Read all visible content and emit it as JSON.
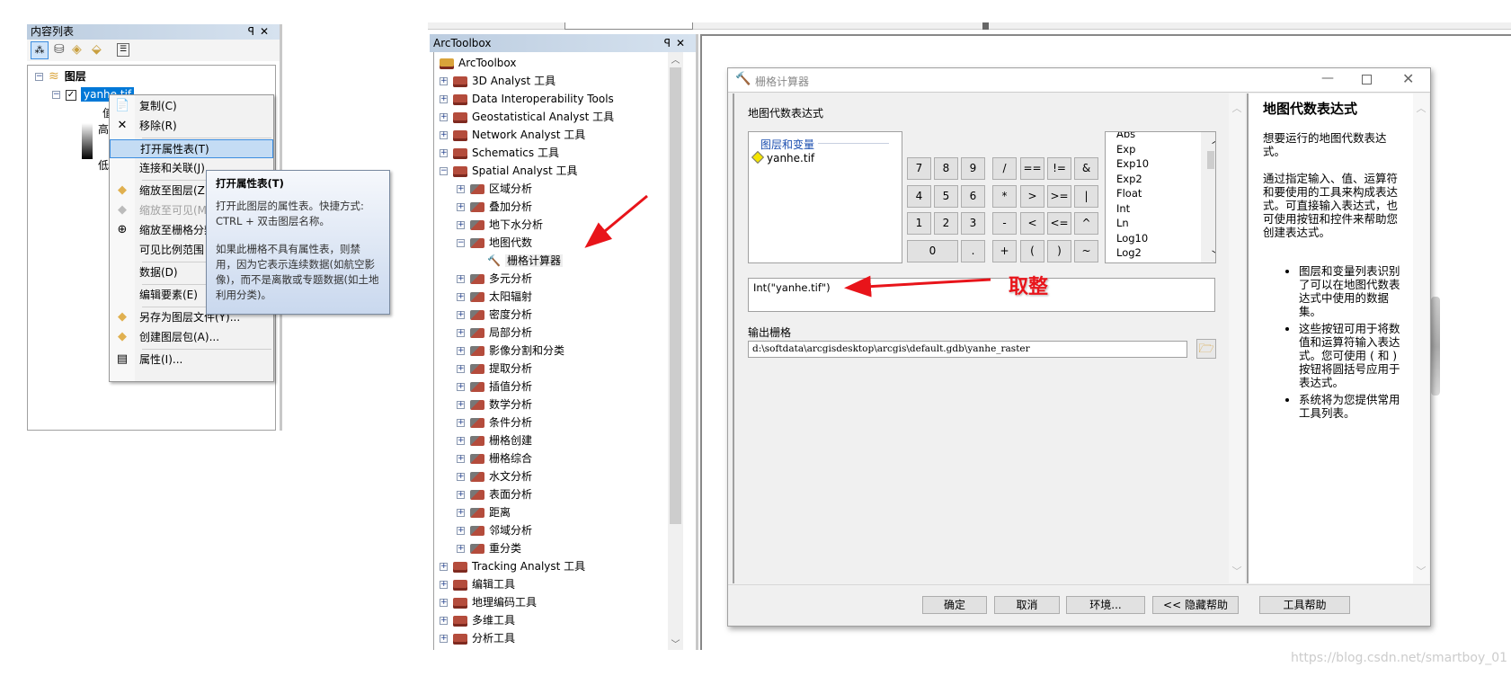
{
  "toc": {
    "title": "内容列表",
    "pin": "ꟼ",
    "close": "✕",
    "layers_label": "图层",
    "layer_name": "yanhe.tif",
    "value_label": "值",
    "high_label": "高",
    "low_label": "低"
  },
  "context_menu": {
    "items": [
      {
        "label": "复制(C)",
        "icon": "copy-icon",
        "glyph": "📄",
        "state": "normal"
      },
      {
        "label": "移除(R)",
        "icon": "remove-icon",
        "glyph": "✕",
        "state": "normal"
      },
      {
        "sep": true
      },
      {
        "label": "打开属性表(T)",
        "icon": "table-icon",
        "glyph": "▦",
        "state": "highlighted"
      },
      {
        "label": "连接和关联(J)",
        "icon": "",
        "glyph": "",
        "state": "normal"
      },
      {
        "sep": true
      },
      {
        "label": "缩放至图层(Z)",
        "icon": "zoom-layer-icon",
        "glyph": "◆",
        "state": "normal"
      },
      {
        "label": "缩放至可见(M)",
        "icon": "zoom-visible-icon",
        "glyph": "◆",
        "state": "disabled"
      },
      {
        "label": "缩放至栅格分辨率",
        "icon": "zoom-raster-icon",
        "glyph": "⊕",
        "state": "normal"
      },
      {
        "label": "可见比例范围",
        "icon": "",
        "glyph": "",
        "state": "normal"
      },
      {
        "sep": true
      },
      {
        "label": "数据(D)",
        "icon": "",
        "glyph": "",
        "state": "normal"
      },
      {
        "sep": true
      },
      {
        "label": "编辑要素(E)",
        "icon": "",
        "glyph": "",
        "state": "normal"
      },
      {
        "sep": true
      },
      {
        "label": "另存为图层文件(Y)...",
        "icon": "layer-file-icon",
        "glyph": "◆",
        "state": "normal"
      },
      {
        "label": "创建图层包(A)...",
        "icon": "layer-package-icon",
        "glyph": "◆",
        "state": "normal"
      },
      {
        "sep": true
      },
      {
        "label": "属性(I)...",
        "icon": "properties-icon",
        "glyph": "▤",
        "state": "normal"
      }
    ]
  },
  "tooltip": {
    "title": "打开属性表(T)",
    "line1": "打开此图层的属性表。快捷方式: CTRL + 双击图层名称。",
    "line2": "如果此栅格不具有属性表，则禁用，因为它表示连续数据(如航空影像)，而不是离散或专题数据(如土地利用分类)。"
  },
  "toolbox": {
    "title": "ArcToolbox",
    "rows": [
      {
        "label": "ArcToolbox",
        "level": 0,
        "type": "root",
        "pm": ""
      },
      {
        "label": "3D Analyst 工具",
        "level": 0,
        "type": "box",
        "pm": "+"
      },
      {
        "label": "Data Interoperability Tools",
        "level": 0,
        "type": "box",
        "pm": "+"
      },
      {
        "label": "Geostatistical Analyst 工具",
        "level": 0,
        "type": "box",
        "pm": "+"
      },
      {
        "label": "Network Analyst 工具",
        "level": 0,
        "type": "box",
        "pm": "+"
      },
      {
        "label": "Schematics 工具",
        "level": 0,
        "type": "box",
        "pm": "+"
      },
      {
        "label": "Spatial Analyst 工具",
        "level": 0,
        "type": "box",
        "pm": "−"
      },
      {
        "label": "区域分析",
        "level": 1,
        "type": "set",
        "pm": "+"
      },
      {
        "label": "叠加分析",
        "level": 1,
        "type": "set",
        "pm": "+"
      },
      {
        "label": "地下水分析",
        "level": 1,
        "type": "set",
        "pm": "+"
      },
      {
        "label": "地图代数",
        "level": 1,
        "type": "set",
        "pm": "−"
      },
      {
        "label": "栅格计算器",
        "level": 2,
        "type": "tool",
        "pm": ""
      },
      {
        "label": "多元分析",
        "level": 1,
        "type": "set",
        "pm": "+"
      },
      {
        "label": "太阳辐射",
        "level": 1,
        "type": "set",
        "pm": "+"
      },
      {
        "label": "密度分析",
        "level": 1,
        "type": "set",
        "pm": "+"
      },
      {
        "label": "局部分析",
        "level": 1,
        "type": "set",
        "pm": "+"
      },
      {
        "label": "影像分割和分类",
        "level": 1,
        "type": "set",
        "pm": "+"
      },
      {
        "label": "提取分析",
        "level": 1,
        "type": "set",
        "pm": "+"
      },
      {
        "label": "插值分析",
        "level": 1,
        "type": "set",
        "pm": "+"
      },
      {
        "label": "数学分析",
        "level": 1,
        "type": "set",
        "pm": "+"
      },
      {
        "label": "条件分析",
        "level": 1,
        "type": "set",
        "pm": "+"
      },
      {
        "label": "栅格创建",
        "level": 1,
        "type": "set",
        "pm": "+"
      },
      {
        "label": "栅格综合",
        "level": 1,
        "type": "set",
        "pm": "+"
      },
      {
        "label": "水文分析",
        "level": 1,
        "type": "set",
        "pm": "+"
      },
      {
        "label": "表面分析",
        "level": 1,
        "type": "set",
        "pm": "+"
      },
      {
        "label": "距离",
        "level": 1,
        "type": "set",
        "pm": "+"
      },
      {
        "label": "邻域分析",
        "level": 1,
        "type": "set",
        "pm": "+"
      },
      {
        "label": "重分类",
        "level": 1,
        "type": "set",
        "pm": "+"
      },
      {
        "label": "Tracking Analyst 工具",
        "level": 0,
        "type": "box",
        "pm": "+"
      },
      {
        "label": "编辑工具",
        "level": 0,
        "type": "box",
        "pm": "+"
      },
      {
        "label": "地理编码工具",
        "level": 0,
        "type": "box",
        "pm": "+"
      },
      {
        "label": "多维工具",
        "level": 0,
        "type": "box",
        "pm": "+"
      },
      {
        "label": "分析工具",
        "level": 0,
        "type": "box",
        "pm": "+"
      }
    ]
  },
  "dialog": {
    "title": "栅格计算器",
    "heading": "地图代数表达式",
    "layers_header": "图层和变量",
    "layer_item": "yanhe.tif",
    "calc_buttons": [
      [
        "7",
        "8",
        "9"
      ],
      [
        "4",
        "5",
        "6"
      ],
      [
        "1",
        "2",
        "3"
      ]
    ],
    "zero": "0",
    "dot": ".",
    "ops": [
      [
        "/",
        "==",
        "!=",
        "&"
      ],
      [
        "*",
        ">",
        ">=",
        "|"
      ],
      [
        "-",
        "<",
        "<=",
        "^"
      ],
      [
        "+",
        "(",
        ")",
        "~"
      ]
    ],
    "functions": [
      "Abs",
      "Exp",
      "Exp10",
      "Exp2",
      "Float",
      "Int",
      "Ln",
      "Log10",
      "Log2"
    ],
    "expression": "Int(\"yanhe.tif\")",
    "output_label": "输出栅格",
    "output_value": "d:\\softdata\\arcgisdesktop\\arcgis\\default.gdb\\yanhe_raster",
    "buttons": {
      "ok": "确定",
      "cancel": "取消",
      "env": "环境...",
      "hide_help": "<< 隐藏帮助",
      "tool_help": "工具帮助"
    },
    "help": {
      "title": "地图代数表达式",
      "p1": "想要运行的地图代数表达式。",
      "p2": "通过指定输入、值、运算符和要使用的工具来构成表达式。可直接输入表达式，也可使用按钮和控件来帮助您创建表达式。",
      "bullets": [
        "图层和变量列表识别了可以在地图代数表达式中使用的数据集。",
        "这些按钮可用于将数值和运算符输入表达式。您可使用 ( 和 ) 按钮将圆括号应用于表达式。",
        "系统将为您提供常用工具列表。"
      ]
    }
  },
  "annotation": {
    "text": "取整",
    "color": "#e8141a"
  },
  "watermark": "https://blog.csdn.net/smartboy_01",
  "colors": {
    "selection": "#0078d7",
    "menu_highlight": "#c4dcf4",
    "arrow": "#e8141a",
    "panel_title": "#c9d8ea"
  }
}
